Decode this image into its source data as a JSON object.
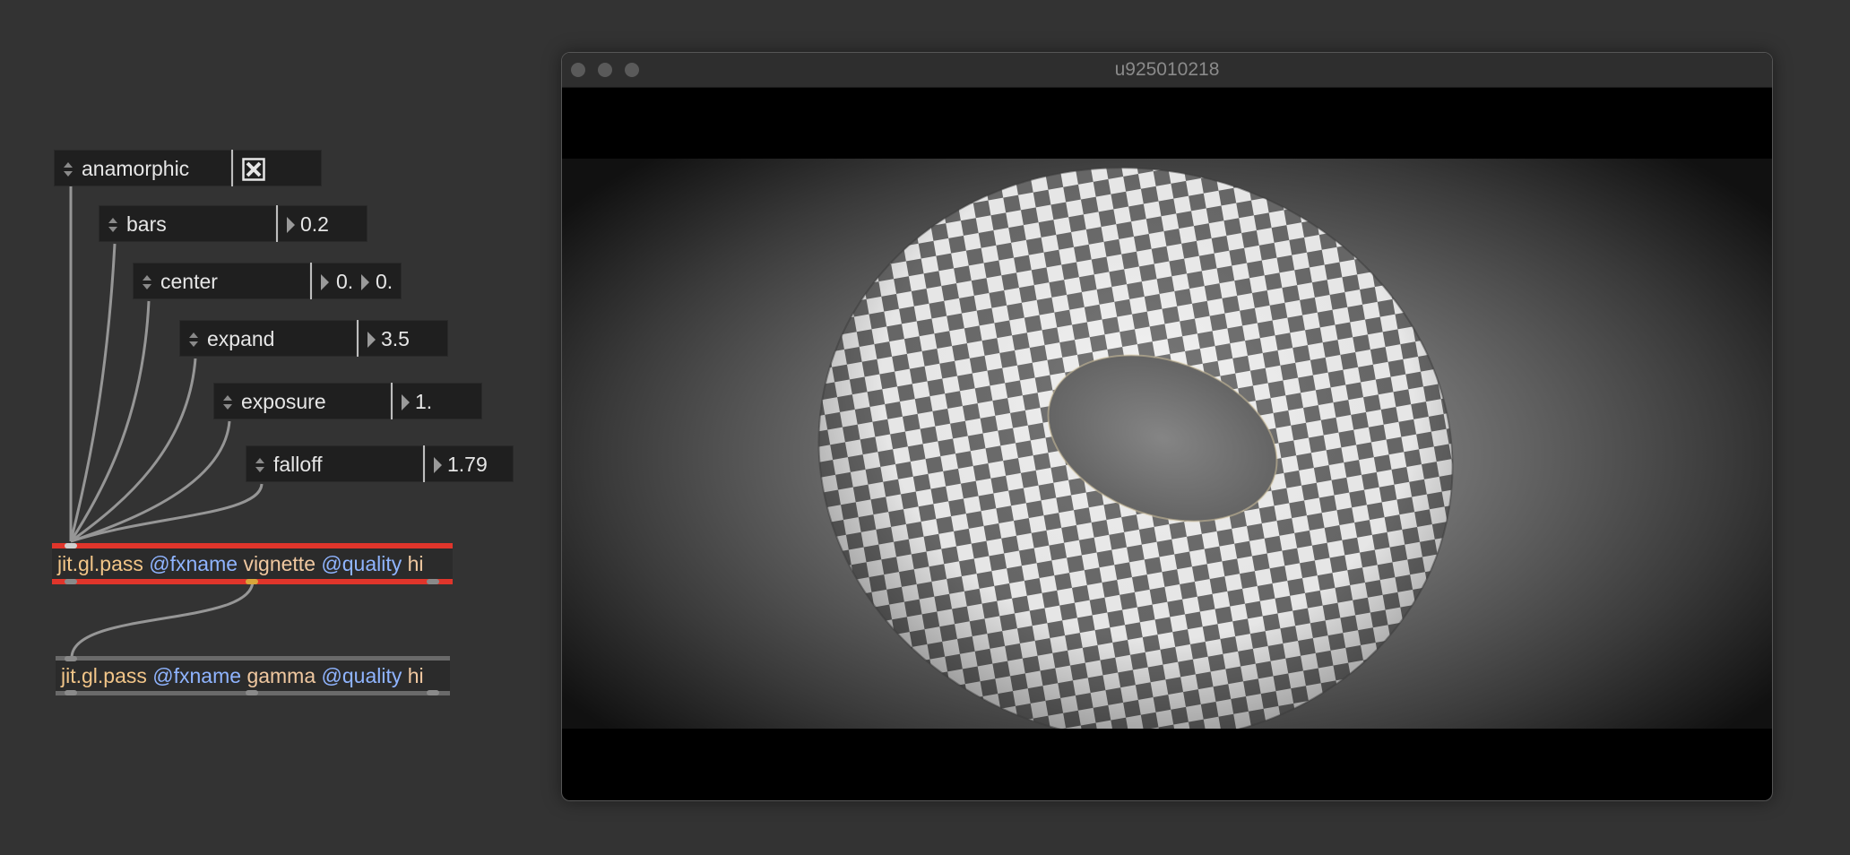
{
  "patch": {
    "attributes": [
      {
        "name": "anamorphic",
        "type": "toggle",
        "checked": true
      },
      {
        "name": "bars",
        "values": [
          "0.2"
        ]
      },
      {
        "name": "center",
        "values": [
          "0.",
          "0."
        ]
      },
      {
        "name": "expand",
        "values": [
          "3.5"
        ]
      },
      {
        "name": "exposure",
        "values": [
          "1."
        ]
      },
      {
        "name": "falloff",
        "values": [
          "1.79"
        ]
      }
    ],
    "objects": [
      {
        "class": "jit.gl.pass",
        "attr1": "@fxname",
        "val1": "vignette",
        "attr2": "@quality",
        "val2": "hi",
        "selected": true
      },
      {
        "class": "jit.gl.pass",
        "attr1": "@fxname",
        "val1": "gamma",
        "attr2": "@quality",
        "val2": "hi",
        "selected": false
      }
    ]
  },
  "window": {
    "title": "u925010218",
    "scene": "checkered-torus"
  },
  "colors": {
    "background": "#333333",
    "selection": "#e0352b",
    "class_text": "#f2c588",
    "attr_text": "#8fb4ff"
  }
}
